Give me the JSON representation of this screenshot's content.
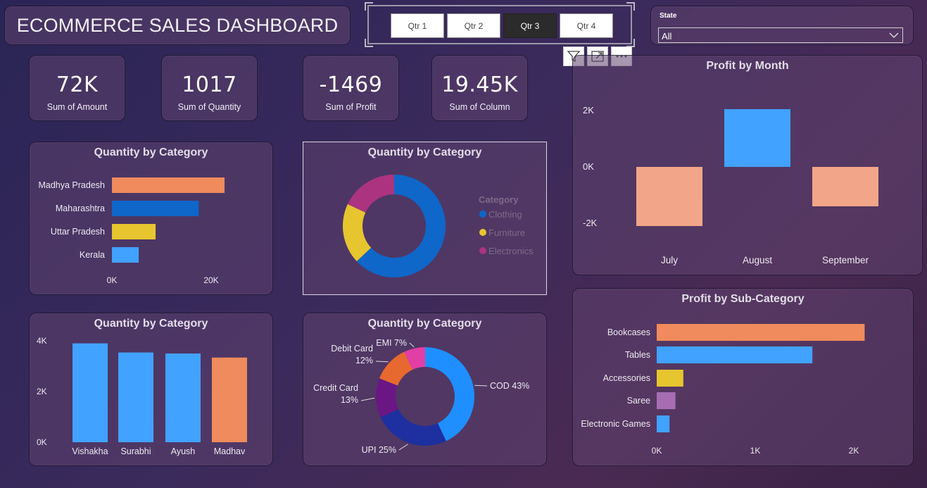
{
  "header": {
    "title": "ECOMMERCE SALES DASHBOARD"
  },
  "quarters": {
    "items": [
      "Qtr 1",
      "Qtr 2",
      "Qtr 3",
      "Qtr 4"
    ],
    "selected": "Qtr 3"
  },
  "state_filter": {
    "label": "State",
    "value": "All"
  },
  "kpis": [
    {
      "value": "72K",
      "label": "Sum of Amount"
    },
    {
      "value": "1017",
      "label": "Sum of Quantity"
    },
    {
      "value": "-1469",
      "label": "Sum of Profit"
    },
    {
      "value": "19.45K",
      "label": "Sum of Column"
    }
  ],
  "colors": {
    "blue": "#42a2ff",
    "darkblue": "#0f67c9",
    "orange": "#ef8b5c",
    "salmon": "#f2a588",
    "yellow": "#e7c52f",
    "purple": "#a66db3",
    "magenta": "#ac3380",
    "navy": "#1e2fa0",
    "violet": "#6a1785",
    "pink": "#e13ea6"
  },
  "chart_data": [
    {
      "id": "qty_by_state",
      "type": "bar",
      "orientation": "horizontal",
      "title": "Quantity by Category",
      "categories": [
        "Madhya Pradesh",
        "Maharashtra",
        "Uttar Pradesh",
        "Kerala"
      ],
      "values": [
        22700,
        17500,
        8800,
        5400
      ],
      "bar_colors": [
        "#ef8b5c",
        "#0f67c9",
        "#e7c52f",
        "#42a2ff"
      ],
      "x_ticks": [
        "0K",
        "20K"
      ],
      "xlim": [
        0,
        20000
      ]
    },
    {
      "id": "qty_by_category_donut",
      "type": "pie",
      "donut": true,
      "title": "Quantity by Category",
      "legend_title": "Category",
      "categories": [
        "Clothing",
        "Furniture",
        "Electronics"
      ],
      "values": [
        63,
        19,
        18
      ],
      "colors": [
        "#0f67c9",
        "#e7c52f",
        "#ac3380"
      ]
    },
    {
      "id": "qty_by_customer",
      "type": "bar",
      "title": "Quantity by Category",
      "categories": [
        "Vishakha",
        "Surabhi",
        "Ayush",
        "Madhav"
      ],
      "values": [
        3900,
        3540,
        3500,
        3340
      ],
      "bar_colors": [
        "#42a2ff",
        "#42a2ff",
        "#42a2ff",
        "#ef8b5c"
      ],
      "y_ticks": [
        "0K",
        "2K",
        "4K"
      ],
      "ylim": [
        0,
        4000
      ]
    },
    {
      "id": "payment_mode",
      "type": "pie",
      "donut": true,
      "title": "Quantity by Category",
      "categories": [
        "COD",
        "UPI",
        "Credit Card",
        "Debit Card",
        "EMI"
      ],
      "values": [
        43,
        25,
        13,
        12,
        7
      ],
      "data_labels": [
        "COD 43%",
        "UPI 25%",
        "Credit Card 13%",
        "Debit Card 12%",
        "EMI 7%"
      ],
      "colors": [
        "#1f8fff",
        "#1e2fa0",
        "#6a1785",
        "#e8692f",
        "#e13ea6"
      ]
    },
    {
      "id": "profit_by_month",
      "type": "bar",
      "subtype": "waterfall",
      "title": "Profit by Month",
      "categories": [
        "July",
        "August",
        "September"
      ],
      "values": [
        -2100,
        2050,
        -1400
      ],
      "bar_colors": [
        "#f2a588",
        "#42a2ff",
        "#f2a588"
      ],
      "y_ticks": [
        "-2K",
        "0K",
        "2K"
      ],
      "ylim": [
        -2500,
        2300
      ]
    },
    {
      "id": "profit_by_subcategory",
      "type": "bar",
      "orientation": "horizontal",
      "title": "Profit by Sub-Category",
      "categories": [
        "Bookcases",
        "Tables",
        "Accessories",
        "Saree",
        "Electronic Games"
      ],
      "values": [
        2110,
        1580,
        270,
        190,
        130
      ],
      "bar_colors": [
        "#ef8b5c",
        "#42a2ff",
        "#e7c52f",
        "#a66db3",
        "#42a2ff"
      ],
      "x_ticks": [
        "0K",
        "1K",
        "2K"
      ],
      "xlim": [
        0,
        2000
      ]
    }
  ]
}
